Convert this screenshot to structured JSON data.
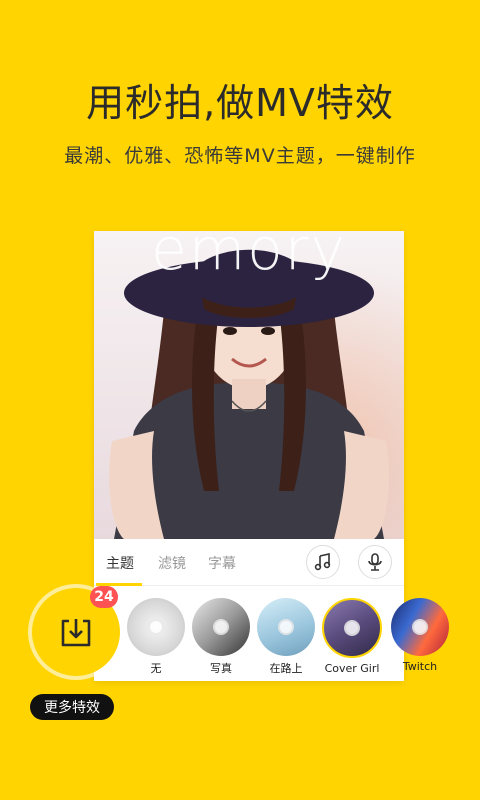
{
  "header": {
    "headline": "用秒拍,做MV特效",
    "subline": "最潮、优雅、恐怖等MV主题，一键制作"
  },
  "preview": {
    "overlay_text": "emory"
  },
  "tabs": [
    {
      "label": "主题",
      "active": true
    },
    {
      "label": "滤镜",
      "active": false
    },
    {
      "label": "字幕",
      "active": false
    }
  ],
  "tools": {
    "music_icon": "music-note-icon",
    "mic_icon": "microphone-icon"
  },
  "themes": [
    {
      "label": "无",
      "colors": [
        "#e8e8e8",
        "#bdbdbd"
      ]
    },
    {
      "label": "写真",
      "colors": [
        "#d9d9d9",
        "#444444"
      ]
    },
    {
      "label": "在路上",
      "colors": [
        "#bfe3f2",
        "#7aa7c7"
      ]
    },
    {
      "label": "Cover Girl",
      "colors": [
        "#6a5a8c",
        "#2f2a47"
      ],
      "selected": true
    },
    {
      "label": "Twitch",
      "colors": [
        "#1b2a6b",
        "#ff6a3d"
      ]
    }
  ],
  "download": {
    "badge_count": "24",
    "icon": "download-tray-icon"
  },
  "more_effects": "更多特效",
  "colors": {
    "background": "#FFD400",
    "badge": "#FF5252",
    "pill": "#111111"
  }
}
